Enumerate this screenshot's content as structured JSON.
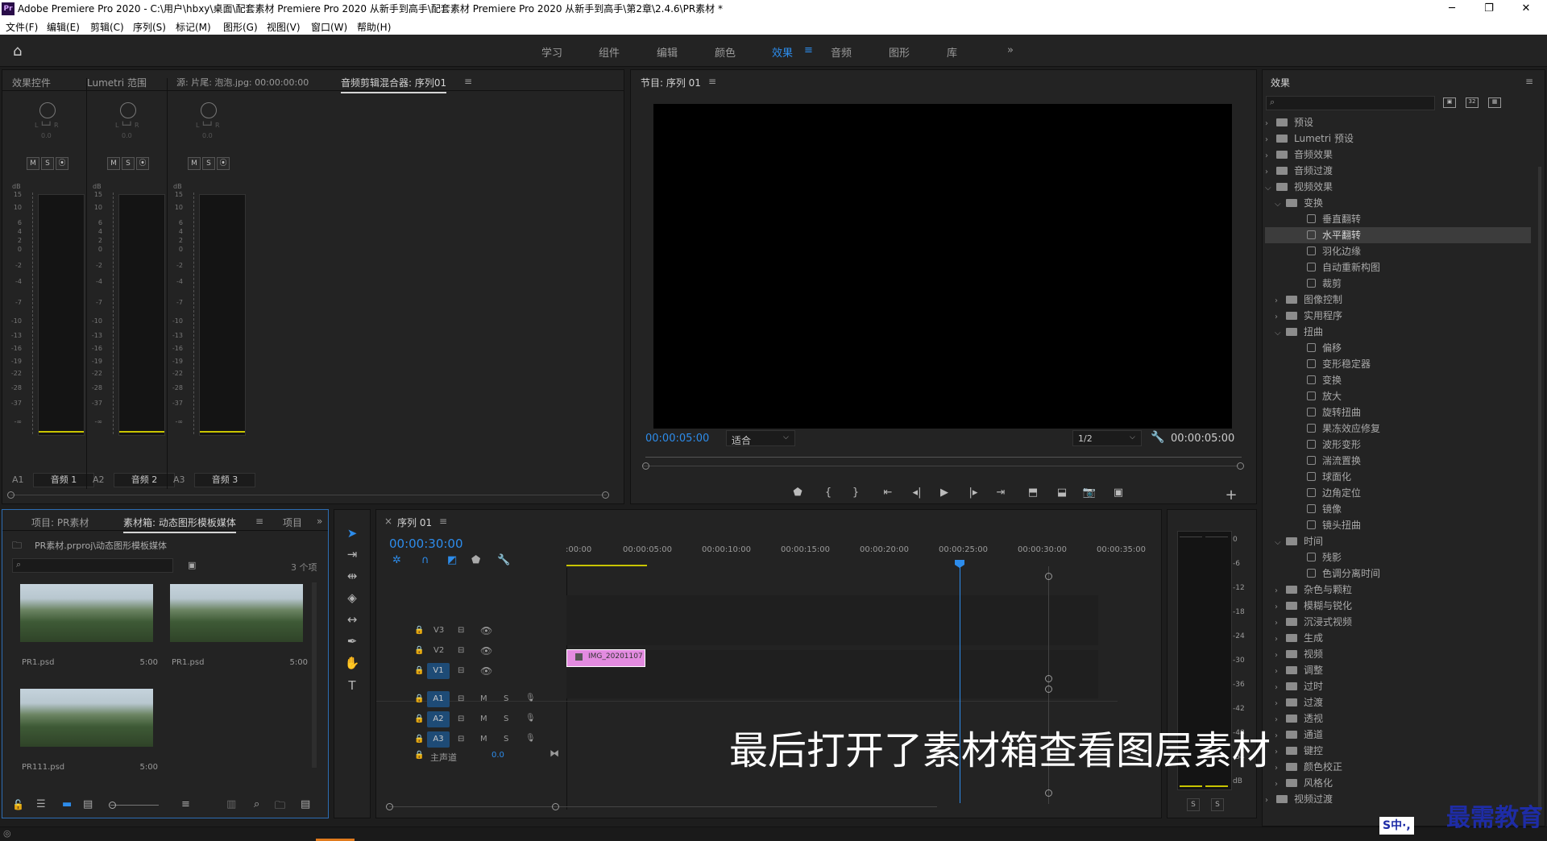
{
  "title_bar": {
    "logo": "Pr",
    "text": "Adobe Premiere Pro 2020 - C:\\用户\\hbxy\\桌面\\配套素材 Premiere Pro 2020 从新手到高手\\配套素材 Premiere Pro 2020 从新手到高手\\第2章\\2.4.6\\PR素材 *",
    "minimize": "─",
    "maximize": "❐",
    "close": "✕"
  },
  "menu": [
    "文件(F)",
    "编辑(E)",
    "剪辑(C)",
    "序列(S)",
    "标记(M)",
    "图形(G)",
    "视图(V)",
    "窗口(W)",
    "帮助(H)"
  ],
  "workspaces": {
    "tabs": [
      "学习",
      "组件",
      "编辑",
      "颜色",
      "效果",
      "音频",
      "图形",
      "库"
    ],
    "active": "效果",
    "more": "»"
  },
  "top_left_panel": {
    "tabs": [
      "效果控件",
      "Lumetri 范围",
      "源: 片尾: 泡泡.jpg: 00:00:00:00",
      "音频剪辑混合器: 序列01"
    ],
    "menu_icon": "≡",
    "lr_label": "L ┗━┛ R",
    "pan_value": "0.0",
    "db_label": "dB",
    "scale": [
      "15",
      "10",
      "6",
      "4",
      "2",
      "0",
      "-2",
      "-4",
      "-7",
      "-10",
      "-13",
      "-16",
      "-19",
      "-22",
      "-28",
      "-37",
      "-∞"
    ],
    "channels": [
      {
        "id": "A1",
        "name": "音频 1",
        "m": "M",
        "s": "S",
        "r": "⦿"
      },
      {
        "id": "A2",
        "name": "音频 2",
        "m": "M",
        "s": "S",
        "r": "⦿"
      },
      {
        "id": "A3",
        "name": "音频 3",
        "m": "M",
        "s": "S",
        "r": "⦿"
      }
    ]
  },
  "program_monitor": {
    "title": "节目: 序列 01",
    "menu_icon": "≡",
    "timecode": "00:00:05:00",
    "fit": "适合",
    "resolution": "1/2",
    "duration": "00:00:05:00",
    "controls": [
      "marker-icon",
      "in-icon",
      "out-icon",
      "go-in-icon",
      "step-back-icon",
      "play-icon",
      "step-forward-icon",
      "go-out-icon",
      "lift-icon",
      "extract-icon",
      "camera-icon",
      "compare-icon",
      "add-icon"
    ]
  },
  "project_panel": {
    "tabs": [
      "项目: PR素材",
      "素材箱: 动态图形模板媒体",
      "项目"
    ],
    "menu_icon": "≡",
    "more": "»",
    "path": "PR素材.prproj\\动态图形模板媒体",
    "count": "3 个项",
    "items": [
      {
        "name": "PR1.psd",
        "duration": "5:00"
      },
      {
        "name": "PR1.psd",
        "duration": "5:00"
      },
      {
        "name": "PR111.psd",
        "duration": "5:00"
      }
    ]
  },
  "timeline": {
    "tab": "序列 01",
    "close": "×",
    "menu_icon": "≡",
    "timecode": "00:00:30:00",
    "ruler": [
      ":00:00",
      "00:00:05:00",
      "00:00:10:00",
      "00:00:15:00",
      "00:00:20:00",
      "00:00:25:00",
      "00:00:30:00",
      "00:00:35:00"
    ],
    "video_tracks": [
      "V3",
      "V2",
      "V1"
    ],
    "audio_tracks": [
      "A1",
      "A2",
      "A3"
    ],
    "master": "主声道",
    "master_value": "0.0",
    "clip_name": "IMG_20201107",
    "m": "M",
    "s": "S"
  },
  "audio_meter": {
    "scale": [
      "0",
      "-6",
      "-12",
      "-18",
      "-24",
      "-30",
      "-36",
      "-42",
      "-48",
      "-54",
      "dB"
    ],
    "solo_left": "S",
    "solo_right": "S"
  },
  "effects_panel": {
    "title": "效果",
    "menu_icon": "≡",
    "tree": [
      {
        "label": "预设",
        "level": 0,
        "kind": "folder",
        "open": false
      },
      {
        "label": "Lumetri 预设",
        "level": 0,
        "kind": "folder",
        "open": false
      },
      {
        "label": "音频效果",
        "level": 0,
        "kind": "folder",
        "open": false
      },
      {
        "label": "音频过渡",
        "level": 0,
        "kind": "folder",
        "open": false
      },
      {
        "label": "视频效果",
        "level": 0,
        "kind": "folder",
        "open": true
      },
      {
        "label": "变换",
        "level": 1,
        "kind": "folder",
        "open": true
      },
      {
        "label": "垂直翻转",
        "level": 2,
        "kind": "effect"
      },
      {
        "label": "水平翻转",
        "level": 2,
        "kind": "effect",
        "selected": true
      },
      {
        "label": "羽化边缘",
        "level": 2,
        "kind": "effect"
      },
      {
        "label": "自动重新构图",
        "level": 2,
        "kind": "effect"
      },
      {
        "label": "裁剪",
        "level": 2,
        "kind": "effect"
      },
      {
        "label": "图像控制",
        "level": 1,
        "kind": "folder",
        "open": false
      },
      {
        "label": "实用程序",
        "level": 1,
        "kind": "folder",
        "open": false
      },
      {
        "label": "扭曲",
        "level": 1,
        "kind": "folder",
        "open": true
      },
      {
        "label": "偏移",
        "level": 2,
        "kind": "effect"
      },
      {
        "label": "变形稳定器",
        "level": 2,
        "kind": "effect"
      },
      {
        "label": "变换",
        "level": 2,
        "kind": "effect"
      },
      {
        "label": "放大",
        "level": 2,
        "kind": "effect"
      },
      {
        "label": "旋转扭曲",
        "level": 2,
        "kind": "effect"
      },
      {
        "label": "果冻效应修复",
        "level": 2,
        "kind": "effect"
      },
      {
        "label": "波形变形",
        "level": 2,
        "kind": "effect"
      },
      {
        "label": "湍流置换",
        "level": 2,
        "kind": "effect"
      },
      {
        "label": "球面化",
        "level": 2,
        "kind": "effect"
      },
      {
        "label": "边角定位",
        "level": 2,
        "kind": "effect"
      },
      {
        "label": "镜像",
        "level": 2,
        "kind": "effect"
      },
      {
        "label": "镜头扭曲",
        "level": 2,
        "kind": "effect"
      },
      {
        "label": "时间",
        "level": 1,
        "kind": "folder",
        "open": true
      },
      {
        "label": "残影",
        "level": 2,
        "kind": "effect"
      },
      {
        "label": "色调分离时间",
        "level": 2,
        "kind": "effect"
      },
      {
        "label": "杂色与颗粒",
        "level": 1,
        "kind": "folder",
        "open": false
      },
      {
        "label": "模糊与锐化",
        "level": 1,
        "kind": "folder",
        "open": false
      },
      {
        "label": "沉浸式视频",
        "level": 1,
        "kind": "folder",
        "open": false
      },
      {
        "label": "生成",
        "level": 1,
        "kind": "folder",
        "open": false
      },
      {
        "label": "视频",
        "level": 1,
        "kind": "folder",
        "open": false
      },
      {
        "label": "调整",
        "level": 1,
        "kind": "folder",
        "open": false
      },
      {
        "label": "过时",
        "level": 1,
        "kind": "folder",
        "open": false
      },
      {
        "label": "过渡",
        "level": 1,
        "kind": "folder",
        "open": false
      },
      {
        "label": "透视",
        "level": 1,
        "kind": "folder",
        "open": false
      },
      {
        "label": "通道",
        "level": 1,
        "kind": "folder",
        "open": false
      },
      {
        "label": "键控",
        "level": 1,
        "kind": "folder",
        "open": false
      },
      {
        "label": "颜色校正",
        "level": 1,
        "kind": "folder",
        "open": false
      },
      {
        "label": "风格化",
        "level": 1,
        "kind": "folder",
        "open": false
      },
      {
        "label": "视频过渡",
        "level": 0,
        "kind": "folder",
        "open": false
      }
    ]
  },
  "caption": "最后打开了素材箱查看图层素材",
  "watermark": "最需教育",
  "ime": "S中·,",
  "colors": {
    "accent": "#2d8ceb",
    "clip": "#e38be0",
    "meter_yellow": "#c8c400",
    "bg": "#232323"
  }
}
